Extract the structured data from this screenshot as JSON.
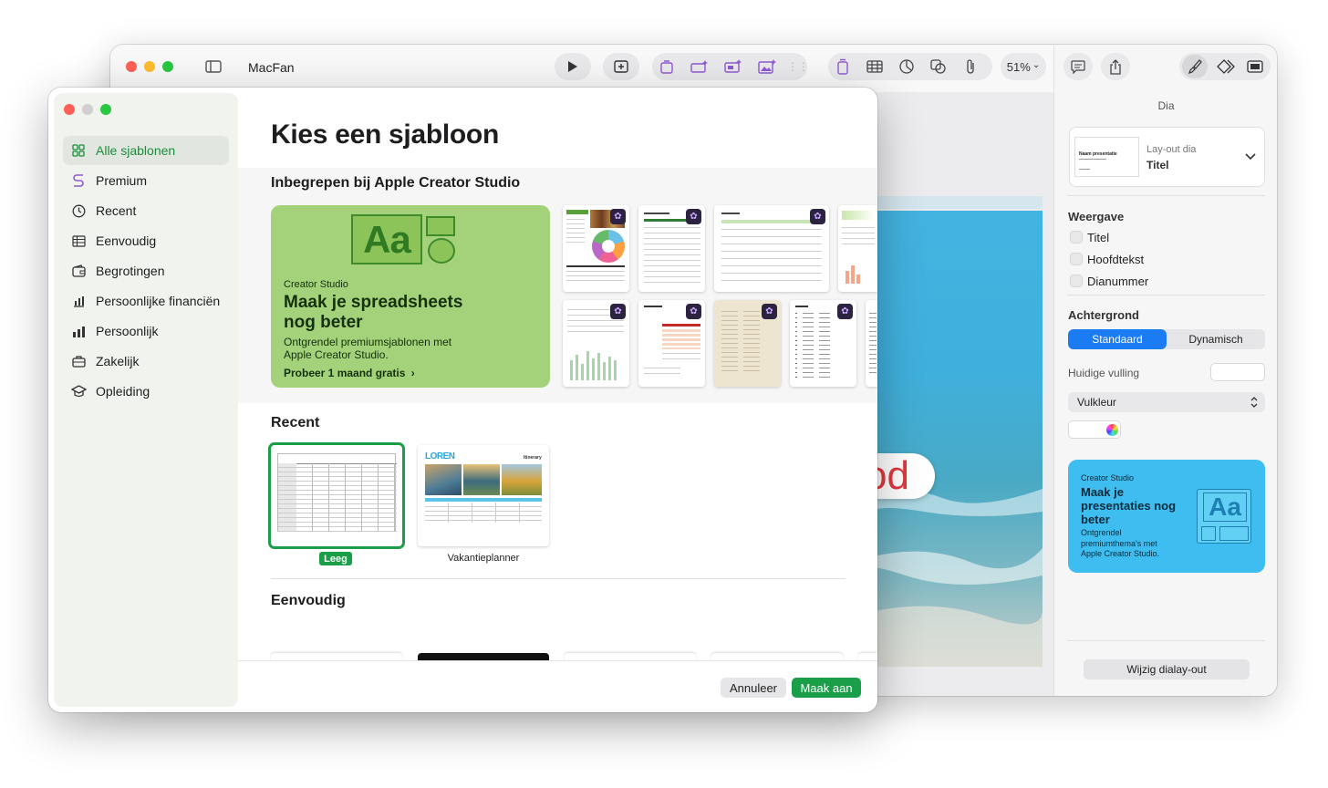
{
  "back_window": {
    "title": "MacFan",
    "zoom": "51%",
    "zoom_chevron": "⌄",
    "slide_text": "od",
    "inspector": {
      "tab_title": "Dia",
      "layout_label": "Lay-out dia",
      "layout_value": "Titel",
      "layout_thumb_title": "Naam presentatie",
      "section_weergave": "Weergave",
      "checkboxes": [
        "Titel",
        "Hoofdtekst",
        "Dianummer"
      ],
      "section_achtergrond": "Achtergrond",
      "segments": [
        "Standaard",
        "Dynamisch"
      ],
      "huidige_vulling": "Huidige vulling",
      "fill_select": "Vulkleur",
      "promo": {
        "brand": "Creator Studio",
        "title": "Maak je presentaties nog beter",
        "body": "Ontgrendel premiumthema's met Apple Creator Studio."
      },
      "edit_layout_button": "Wijzig dialay-out"
    }
  },
  "front_window": {
    "heading": "Kies een sjabloon",
    "sidebar": [
      {
        "label": "Alle sjablonen",
        "icon": "grid-icon"
      },
      {
        "label": "Premium",
        "icon": "premium-icon"
      },
      {
        "label": "Recent",
        "icon": "clock-icon"
      },
      {
        "label": "Eenvoudig",
        "icon": "table-icon"
      },
      {
        "label": "Begrotingen",
        "icon": "wallet-icon"
      },
      {
        "label": "Persoonlijke financiën",
        "icon": "finance-icon"
      },
      {
        "label": "Persoonlijk",
        "icon": "chart-bars-icon"
      },
      {
        "label": "Zakelijk",
        "icon": "briefcase-icon"
      },
      {
        "label": "Opleiding",
        "icon": "graduation-cap-icon"
      }
    ],
    "included_title": "Inbegrepen bij Apple Creator Studio",
    "promo": {
      "brand": "Creator Studio",
      "title_line1": "Maak je spreadsheets",
      "title_line2": "nog beter",
      "body_line1": "Ontgrendel premiumsjablonen met",
      "body_line2": "Apple Creator Studio.",
      "cta": "Probeer 1 maand gratis",
      "cta_chevron": "›",
      "icon_text": "Aa"
    },
    "recent_title": "Recent",
    "recent_items": [
      {
        "label": "Leeg",
        "selected": true
      },
      {
        "label": "Vakantieplanner",
        "selected": false,
        "thumb_title": "LOREN",
        "thumb_subtitle": "Itinerary"
      }
    ],
    "simple_title": "Eenvoudig",
    "buttons": {
      "cancel": "Annuleer",
      "create": "Maak aan"
    }
  },
  "colors": {
    "accent_green": "#1a9e48",
    "promo_green": "#a4d27a",
    "promo_blue": "#3dbdf0",
    "segment_blue": "#1a7bf2"
  }
}
